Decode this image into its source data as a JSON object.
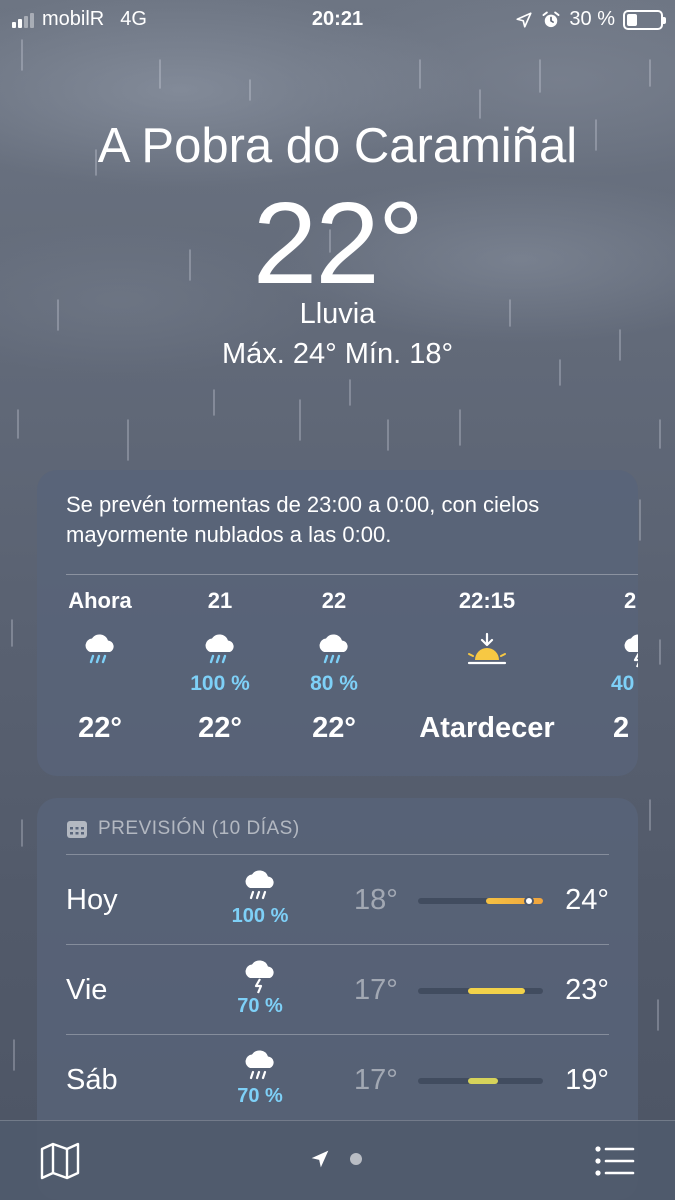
{
  "status_bar": {
    "carrier": "mobilR",
    "network": "4G",
    "time": "20:21",
    "battery": "30 %",
    "battery_level": 0.3,
    "icons": [
      "signal-icon",
      "location-arrow-icon",
      "alarm-icon",
      "battery-icon"
    ]
  },
  "header": {
    "city": "A Pobra do Caramiñal",
    "temperature": "22°",
    "condition": "Lluvia",
    "hilo": "Máx. 24°  Mín. 18°"
  },
  "hourly": {
    "summary": "Se prevén tormentas de 23:00 a 0:00, con cielos mayormente nublados a las 0:00.",
    "items": [
      {
        "label": "Ahora",
        "icon": "rain-cloud-icon",
        "precip": "",
        "temp": "22°"
      },
      {
        "label": "21",
        "icon": "rain-cloud-icon",
        "precip": "100 %",
        "temp": "22°"
      },
      {
        "label": "22",
        "icon": "rain-cloud-icon",
        "precip": "80 %",
        "temp": "22°"
      },
      {
        "label": "22:15",
        "icon": "sunset-icon",
        "precip": "",
        "temp": "Atardecer"
      },
      {
        "label": "2",
        "icon": "thunderstorm-icon",
        "precip": "40",
        "temp": "2"
      }
    ]
  },
  "daily": {
    "heading": "PREVISIÓN (10 DÍAS)",
    "heading_icon": "calendar-icon",
    "range": [
      17,
      24
    ],
    "days": [
      {
        "name": "Hoy",
        "icon": "rain-cloud-icon",
        "precip": "100 %",
        "low": "18°",
        "high": "24°",
        "low_value": 18,
        "high_value": 24,
        "current": 22,
        "bar_color": "#f5c142",
        "bar_color_end": "#f0a43e"
      },
      {
        "name": "Vie",
        "icon": "thunderstorm-icon",
        "precip": "70 %",
        "low": "17°",
        "high": "23°",
        "low_value": 17,
        "high_value": 23,
        "bar_color": "#f2d24a"
      },
      {
        "name": "Sáb",
        "icon": "rain-cloud-icon",
        "precip": "70 %",
        "low": "17°",
        "high": "19°",
        "low_value": 17,
        "high_value": 19,
        "bar_color": "#d6d35a"
      }
    ]
  },
  "toolbar": {
    "map_icon": "map-icon",
    "location_icon": "location-arrow-icon",
    "list_icon": "list-icon"
  }
}
